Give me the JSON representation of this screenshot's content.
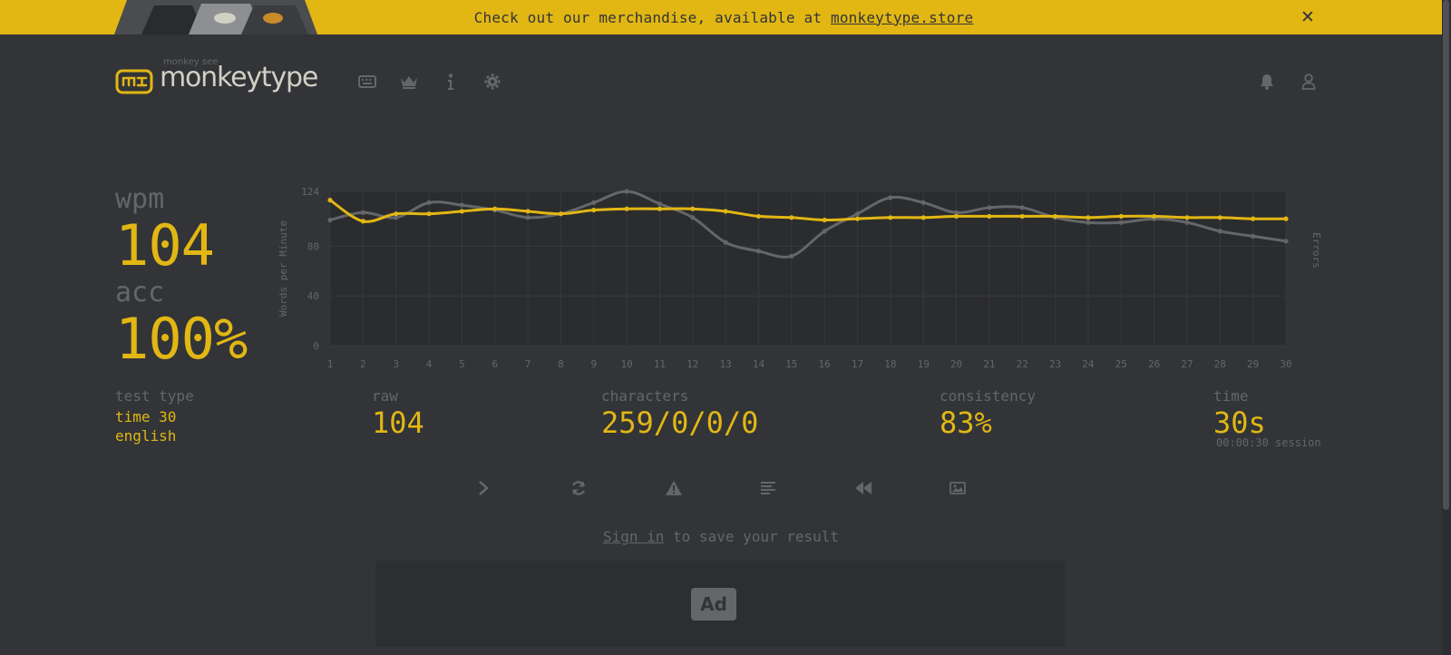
{
  "banner": {
    "text_before": "Check out our merchandise, available at ",
    "link_text": "monkeytype.store",
    "close_label": "✕"
  },
  "header": {
    "logo_top": "monkey see",
    "logo_text": "monkeytype",
    "nav_icons": [
      "keyboard-icon",
      "crown-icon",
      "info-icon",
      "gear-icon"
    ],
    "right_icons": [
      "bell-icon",
      "user-icon"
    ]
  },
  "result": {
    "wpm_label": "wpm",
    "wpm_value": "104",
    "acc_label": "acc",
    "acc_value": "100%",
    "test_type_label": "test type",
    "test_type_line1": "time 30",
    "test_type_line2": "english",
    "raw_label": "raw",
    "raw_value": "104",
    "characters_label": "characters",
    "characters_value": "259/0/0/0",
    "consistency_label": "consistency",
    "consistency_value": "83%",
    "time_label": "time",
    "time_value": "30s",
    "session_text": "00:00:30 session"
  },
  "chart_data": {
    "type": "line",
    "ylabel": "Words per Minute",
    "y2label": "Errors",
    "ylim": [
      0,
      124
    ],
    "yticks": [
      0,
      40,
      80,
      124
    ],
    "x": [
      1,
      2,
      3,
      4,
      5,
      6,
      7,
      8,
      9,
      10,
      11,
      12,
      13,
      14,
      15,
      16,
      17,
      18,
      19,
      20,
      21,
      22,
      23,
      24,
      25,
      26,
      27,
      28,
      29,
      30
    ],
    "series": [
      {
        "color": "#e2b714",
        "values": [
          117,
          100,
          106,
          106,
          108,
          110,
          108,
          106,
          109,
          110,
          110,
          110,
          108,
          104,
          103,
          101,
          102,
          103,
          103,
          104,
          104,
          104,
          104,
          103,
          104,
          104,
          103,
          103,
          102,
          102
        ]
      },
      {
        "color": "#646669",
        "values": [
          101,
          107,
          103,
          115,
          113,
          109,
          103,
          106,
          115,
          124,
          114,
          103,
          83,
          76,
          72,
          92,
          106,
          119,
          115,
          107,
          111,
          111,
          103,
          99,
          99,
          102,
          99,
          92,
          88,
          84
        ]
      }
    ],
    "grid": true
  },
  "actions": [
    "next-test",
    "restart",
    "report",
    "words-history",
    "replay",
    "screenshot"
  ],
  "signin": {
    "link": "Sign in",
    "rest": " to save your result"
  },
  "ad": {
    "label": "Ad"
  }
}
